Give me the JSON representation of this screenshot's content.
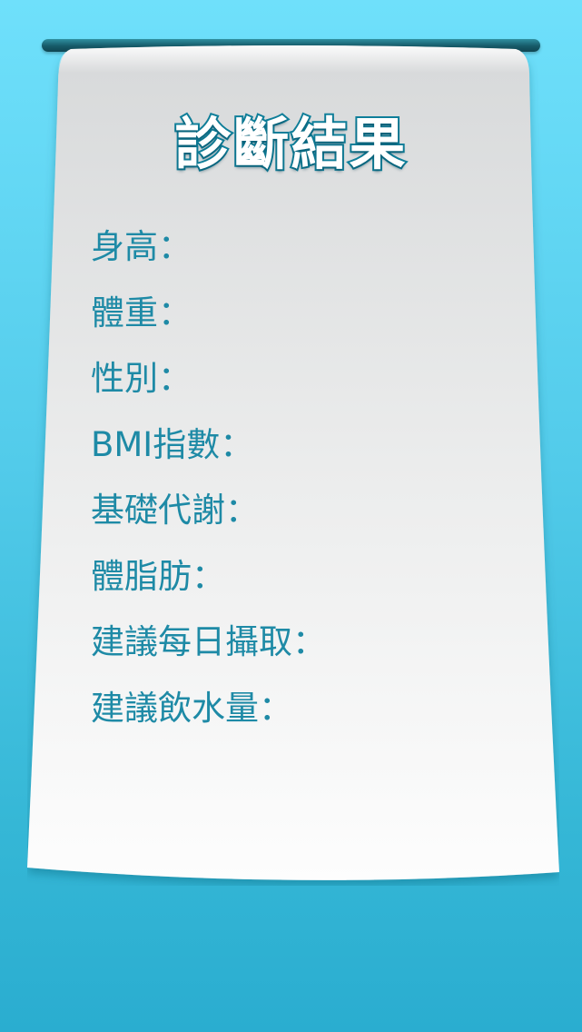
{
  "title": "診斷結果",
  "fields": [
    "身高：",
    "體重：",
    "性別：",
    "BMI指數：",
    "基礎代謝：",
    "體脂肪：",
    "建議每日攝取：",
    "建議飲水量："
  ],
  "colors": {
    "background_top": "#6fe0fb",
    "background_bottom": "#2aadd0",
    "rod": "#165a68",
    "label_text": "#1e8aa6",
    "title_outline": "#0f7f9a"
  }
}
